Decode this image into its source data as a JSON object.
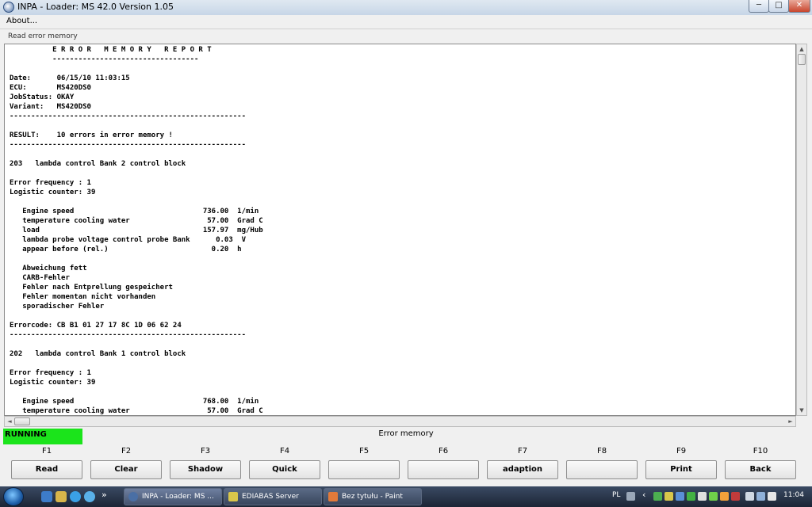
{
  "window": {
    "title": "INPA - Loader:  MS 42.0 Version 1.05",
    "min_glyph": "─",
    "max_glyph": "□",
    "close_glyph": "✕"
  },
  "menu": {
    "about": "About..."
  },
  "section_label": "Read error memory",
  "report_text": "          E R R O R   M E M O R Y   R E P O R T\n          ----------------------------------\n\nDate:      06/15/10 11:03:15\nECU:       MS420DS0\nJobStatus: OKAY\nVariant:   MS420DS0\n-------------------------------------------------------\n\nRESULT:    10 errors in error memory !\n-------------------------------------------------------\n\n203   lambda control Bank 2 control block\n\nError frequency : 1\nLogistic counter: 39\n\n   Engine speed                              736.00  1/min\n   temperature cooling water                  57.00  Grad C\n   load                                      157.97  mg/Hub\n   lambda probe voltage control probe Bank      0.03  V\n   appear before (rel.)                        0.20  h\n\n   Abweichung fett\n   CARB-Fehler\n   Fehler nach Entprellung gespeichert\n   Fehler momentan nicht vorhanden\n   sporadischer Fehler\n\nErrorcode: CB B1 01 27 17 8C 1D 06 62 24\n-------------------------------------------------------\n\n202   lambda control Bank 1 control block\n\nError frequency : 1\nLogistic counter: 39\n\n   Engine speed                              768.00  1/min\n   temperature cooling water                  57.00  Grad C",
  "scroll": {
    "up": "▲",
    "down": "▼",
    "left": "◄",
    "right": "►"
  },
  "status": {
    "state": "RUNNING",
    "state_color": "#1be41b",
    "screen_title": "Error memory"
  },
  "fkeys": [
    {
      "key": "F1",
      "label": "Read"
    },
    {
      "key": "F2",
      "label": "Clear"
    },
    {
      "key": "F3",
      "label": "Shadow"
    },
    {
      "key": "F4",
      "label": "Quick"
    },
    {
      "key": "F5",
      "label": ""
    },
    {
      "key": "F6",
      "label": ""
    },
    {
      "key": "F7",
      "label": "adaption"
    },
    {
      "key": "F8",
      "label": ""
    },
    {
      "key": "F9",
      "label": "Print"
    },
    {
      "key": "F10",
      "label": "Back"
    }
  ],
  "taskbar": {
    "tasks": [
      {
        "label": "INPA - Loader:  MS ...",
        "icon": "inpa-icon",
        "color": "#4a6fa5"
      },
      {
        "label": "EDIABAS Server",
        "icon": "server-icon",
        "color": "#d9c64a"
      },
      {
        "label": "Bez tytułu - Paint",
        "icon": "paint-icon",
        "color": "#e27a3a"
      }
    ],
    "quick_launch_chevron": "»",
    "tray_chevron": "‹",
    "language": "PL",
    "clock": "11:04"
  }
}
